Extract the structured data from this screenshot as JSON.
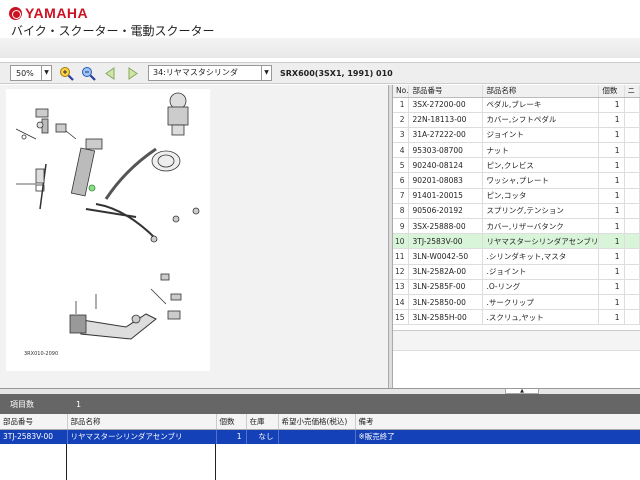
{
  "header": {
    "brand": "YAMAHA",
    "subtitle": "バイク・スクーター・電動スクーター"
  },
  "toolbar": {
    "zoom_value": "50%",
    "page_select_value": "34:リヤマスタシリンダ",
    "model_label": "SRX600(3SX1, 1991) 010"
  },
  "diagram": {
    "ref_code": "3RX010-2090"
  },
  "parts_table": {
    "headers": [
      "No.",
      "部品番号",
      "部品名称",
      "個数",
      "ニ"
    ],
    "rows": [
      {
        "no": "1",
        "part_no": "3SX-27200-00",
        "name": "ペダル,ブレーキ",
        "qty": "1"
      },
      {
        "no": "2",
        "part_no": "22N-18113-00",
        "name": "カバー,シフトペダル",
        "qty": "1"
      },
      {
        "no": "3",
        "part_no": "31A-27222-00",
        "name": "ジョイント",
        "qty": "1"
      },
      {
        "no": "4",
        "part_no": "95303-08700",
        "name": "ナット",
        "qty": "1"
      },
      {
        "no": "5",
        "part_no": "90240-08124",
        "name": "ピン,クレビス",
        "qty": "1"
      },
      {
        "no": "6",
        "part_no": "90201-08083",
        "name": "ワッシャ,プレート",
        "qty": "1"
      },
      {
        "no": "7",
        "part_no": "91401-20015",
        "name": "ピン,コッタ",
        "qty": "1"
      },
      {
        "no": "8",
        "part_no": "90506-20192",
        "name": "スプリング,テンション",
        "qty": "1"
      },
      {
        "no": "9",
        "part_no": "3SX-25888-00",
        "name": "カバー,リザーバタンク",
        "qty": "1"
      },
      {
        "no": "10",
        "part_no": "3TJ-2583V-00",
        "name": "リヤマスターシリンダアセンブリ",
        "qty": "1"
      },
      {
        "no": "11",
        "part_no": "3LN-W0042-50",
        "name": ".シリンダキット,マスタ",
        "qty": "1"
      },
      {
        "no": "12",
        "part_no": "3LN-2582A-00",
        "name": ".ジョイント",
        "qty": "1"
      },
      {
        "no": "13",
        "part_no": "3LN-2585F-00",
        "name": ".O-リング",
        "qty": "1"
      },
      {
        "no": "14",
        "part_no": "3LN-25850-00",
        "name": ".サークリップ",
        "qty": "1"
      },
      {
        "no": "15",
        "part_no": "3LN-2585H-00",
        "name": ".スクリュ,ヤット",
        "qty": "1"
      }
    ],
    "selected_index": 9
  },
  "count_bar": {
    "label": "項目数",
    "value": "1"
  },
  "order_table": {
    "headers": [
      "部品番号",
      "部品名称",
      "個数",
      "在庫",
      "希望小売価格(税込)",
      "備考"
    ],
    "rows": [
      {
        "part_no": "3TJ-2583V-00",
        "name": "リヤマスターシリンダアセンブリ",
        "qty": "1",
        "stock": "なし",
        "price": "",
        "note": "※販売終了"
      }
    ]
  },
  "colors": {
    "brand_red": "#cc1122",
    "selection_green": "#d9f5d9",
    "selection_blue": "#1440b8",
    "count_bar_bg": "#666666"
  }
}
